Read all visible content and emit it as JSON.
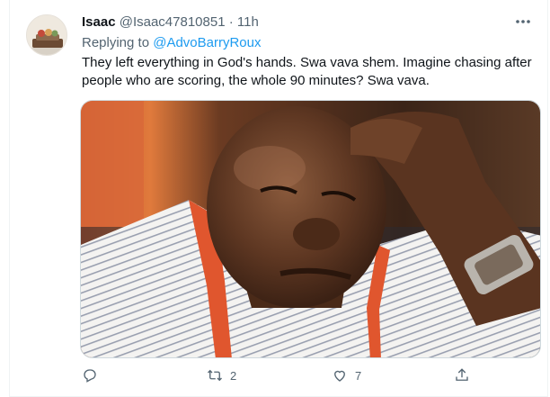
{
  "tweet": {
    "author_name": "Isaac",
    "handle": "@Isaac47810851",
    "separator": "·",
    "time": "11h",
    "reply_prefix": "Replying to",
    "reply_to": "@AdvoBarryRoux",
    "text": "They left everything in God's hands. Swa vava shem. Imagine chasing after people who are scoring, the whole 90 minutes? Swa vava."
  },
  "actions": {
    "reply_count": "",
    "retweet_count": "2",
    "like_count": "7"
  },
  "icons": {
    "more": "more-horizontal-icon",
    "reply": "reply-icon",
    "retweet": "retweet-icon",
    "like": "heart-icon",
    "share": "share-icon"
  },
  "colors": {
    "link": "#1d9bf0",
    "secondary_text": "#536471",
    "primary_text": "#0f1419"
  }
}
